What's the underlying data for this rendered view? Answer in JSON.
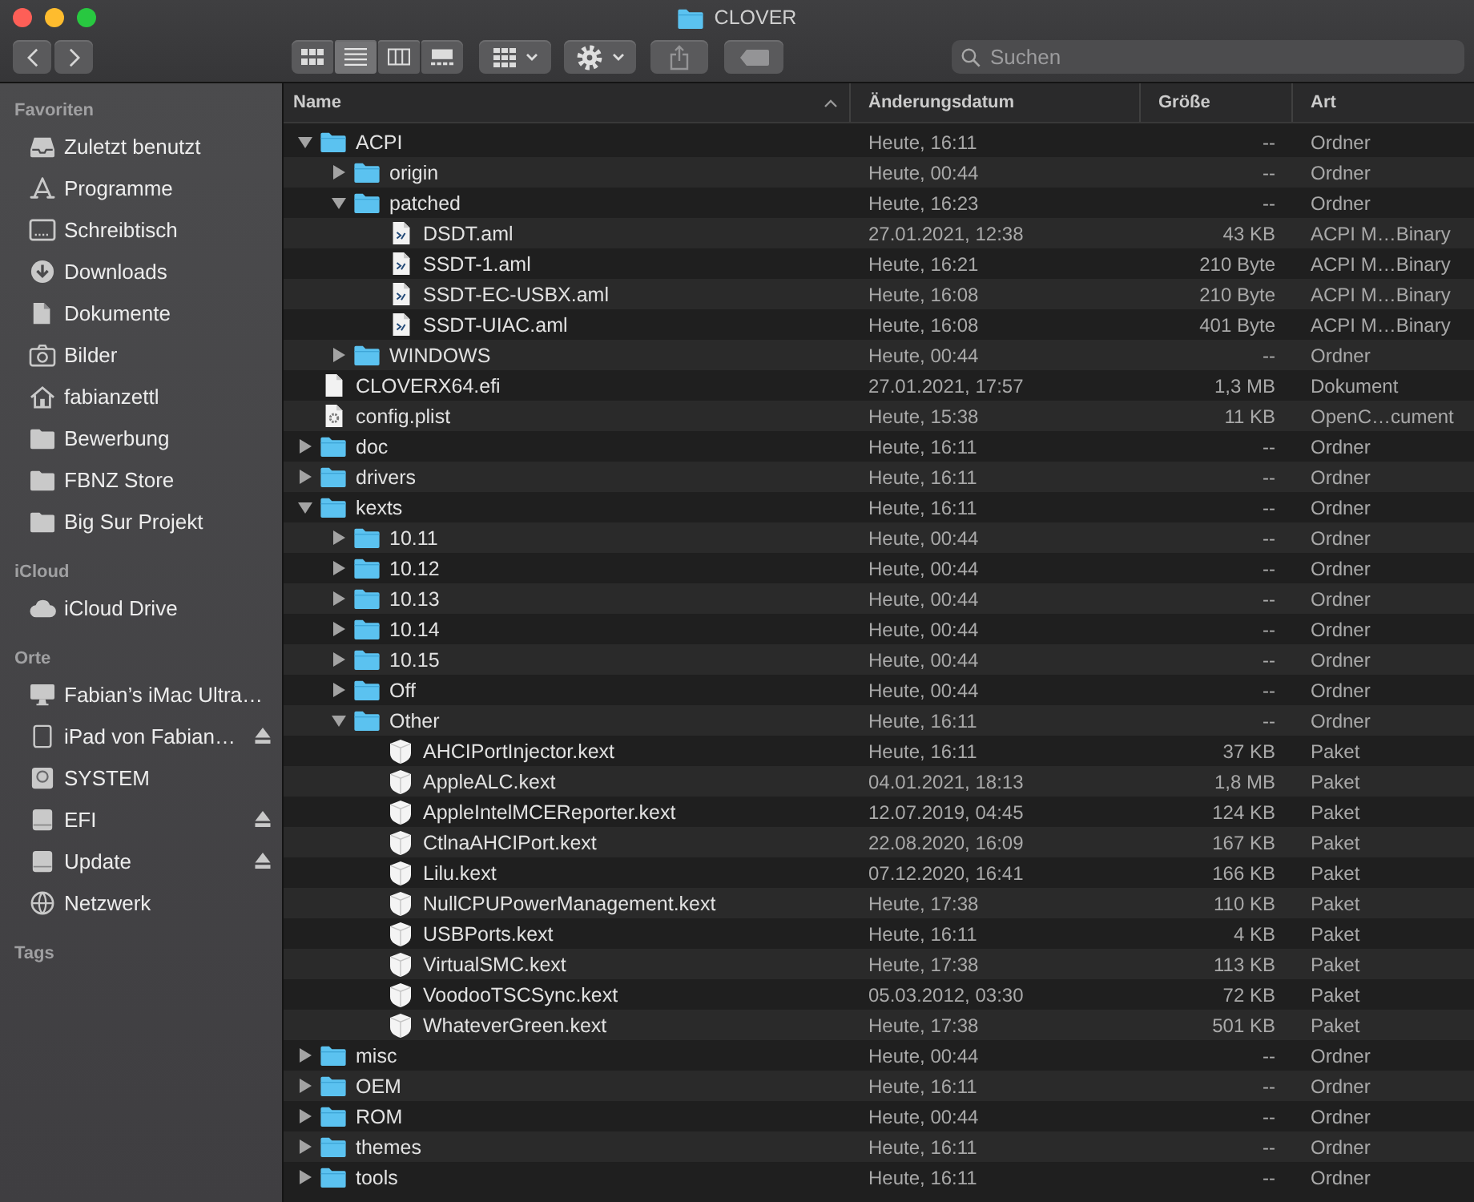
{
  "window": {
    "title": "CLOVER"
  },
  "toolbar": {
    "view_modes": [
      {
        "selected": false
      },
      {
        "selected": true
      },
      {
        "selected": false
      },
      {
        "selected": false
      }
    ],
    "group_button": {
      "disabled": false
    },
    "action_button": {
      "disabled": false
    },
    "share_button": {
      "disabled": true
    },
    "tag_button": {
      "disabled": true
    },
    "search": {
      "placeholder": "Suchen"
    }
  },
  "sidebar": {
    "sections": [
      {
        "title": "Favoriten",
        "items": [
          {
            "label": "Zuletzt benutzt"
          },
          {
            "label": "Programme"
          },
          {
            "label": "Schreibtisch"
          },
          {
            "label": "Downloads"
          },
          {
            "label": "Dokumente"
          },
          {
            "label": "Bilder"
          },
          {
            "label": "fabianzettl"
          },
          {
            "label": "Bewerbung"
          },
          {
            "label": "FBNZ Store"
          },
          {
            "label": "Big Sur Projekt"
          }
        ]
      },
      {
        "title": "iCloud",
        "items": [
          {
            "label": "iCloud Drive"
          }
        ]
      },
      {
        "title": "Orte",
        "items": [
          {
            "label": "Fabian’s iMac Ultra…",
            "ejectable": false
          },
          {
            "label": "iPad von Fabian…",
            "ejectable": true
          },
          {
            "label": "SYSTEM",
            "ejectable": false
          },
          {
            "label": "EFI",
            "ejectable": true
          },
          {
            "label": "Update",
            "ejectable": true
          },
          {
            "label": "Netzwerk",
            "ejectable": false
          }
        ]
      },
      {
        "title": "Tags"
      }
    ]
  },
  "table": {
    "columns": [
      {
        "label": "Name",
        "sorted": true
      },
      {
        "label": "Änderungsdatum",
        "sorted": false
      },
      {
        "label": "Größe",
        "sorted": false
      },
      {
        "label": "Art",
        "sorted": false
      }
    ],
    "rows": [
      {
        "name": "ACPI",
        "kind": "folder",
        "expanded": true,
        "modified": "Heute, 16:11",
        "size": "--",
        "type": "Ordner",
        "children": [
          {
            "name": "origin",
            "kind": "folder",
            "expanded": false,
            "modified": "Heute, 00:44",
            "size": "--",
            "type": "Ordner"
          },
          {
            "name": "patched",
            "kind": "folder",
            "expanded": true,
            "modified": "Heute, 16:23",
            "size": "--",
            "type": "Ordner",
            "children": [
              {
                "name": "DSDT.aml",
                "kind": "aml",
                "modified": "27.01.2021, 12:38",
                "size": "43 KB",
                "type": "ACPI M…Binary"
              },
              {
                "name": "SSDT-1.aml",
                "kind": "aml",
                "modified": "Heute, 16:21",
                "size": "210 Byte",
                "type": "ACPI M…Binary"
              },
              {
                "name": "SSDT-EC-USBX.aml",
                "kind": "aml",
                "modified": "Heute, 16:08",
                "size": "210 Byte",
                "type": "ACPI M…Binary"
              },
              {
                "name": "SSDT-UIAC.aml",
                "kind": "aml",
                "modified": "Heute, 16:08",
                "size": "401 Byte",
                "type": "ACPI M…Binary"
              }
            ]
          },
          {
            "name": "WINDOWS",
            "kind": "folder",
            "expanded": false,
            "modified": "Heute, 00:44",
            "size": "--",
            "type": "Ordner"
          }
        ]
      },
      {
        "name": "CLOVERX64.efi",
        "kind": "document",
        "modified": "27.01.2021, 17:57",
        "size": "1,3 MB",
        "type": "Dokument"
      },
      {
        "name": "config.plist",
        "kind": "plist",
        "modified": "Heute, 15:38",
        "size": "11 KB",
        "type": "OpenC…cument"
      },
      {
        "name": "doc",
        "kind": "folder",
        "expanded": false,
        "modified": "Heute, 16:11",
        "size": "--",
        "type": "Ordner"
      },
      {
        "name": "drivers",
        "kind": "folder",
        "expanded": false,
        "modified": "Heute, 16:11",
        "size": "--",
        "type": "Ordner"
      },
      {
        "name": "kexts",
        "kind": "folder",
        "expanded": true,
        "modified": "Heute, 16:11",
        "size": "--",
        "type": "Ordner",
        "children": [
          {
            "name": "10.11",
            "kind": "folder",
            "expanded": false,
            "modified": "Heute, 00:44",
            "size": "--",
            "type": "Ordner"
          },
          {
            "name": "10.12",
            "kind": "folder",
            "expanded": false,
            "modified": "Heute, 00:44",
            "size": "--",
            "type": "Ordner"
          },
          {
            "name": "10.13",
            "kind": "folder",
            "expanded": false,
            "modified": "Heute, 00:44",
            "size": "--",
            "type": "Ordner"
          },
          {
            "name": "10.14",
            "kind": "folder",
            "expanded": false,
            "modified": "Heute, 00:44",
            "size": "--",
            "type": "Ordner"
          },
          {
            "name": "10.15",
            "kind": "folder",
            "expanded": false,
            "modified": "Heute, 00:44",
            "size": "--",
            "type": "Ordner"
          },
          {
            "name": "Off",
            "kind": "folder",
            "expanded": false,
            "modified": "Heute, 00:44",
            "size": "--",
            "type": "Ordner"
          },
          {
            "name": "Other",
            "kind": "folder",
            "expanded": true,
            "modified": "Heute, 16:11",
            "size": "--",
            "type": "Ordner",
            "children": [
              {
                "name": "AHCIPortInjector.kext",
                "kind": "kext",
                "modified": "Heute, 16:11",
                "size": "37 KB",
                "type": "Paket"
              },
              {
                "name": "AppleALC.kext",
                "kind": "kext",
                "modified": "04.01.2021, 18:13",
                "size": "1,8 MB",
                "type": "Paket"
              },
              {
                "name": "AppleIntelMCEReporter.kext",
                "kind": "kext",
                "modified": "12.07.2019, 04:45",
                "size": "124 KB",
                "type": "Paket"
              },
              {
                "name": "CtlnaAHCIPort.kext",
                "kind": "kext",
                "modified": "22.08.2020, 16:09",
                "size": "167 KB",
                "type": "Paket"
              },
              {
                "name": "Lilu.kext",
                "kind": "kext",
                "modified": "07.12.2020, 16:41",
                "size": "166 KB",
                "type": "Paket"
              },
              {
                "name": "NullCPUPowerManagement.kext",
                "kind": "kext",
                "modified": "Heute, 17:38",
                "size": "110 KB",
                "type": "Paket"
              },
              {
                "name": "USBPorts.kext",
                "kind": "kext",
                "modified": "Heute, 16:11",
                "size": "4 KB",
                "type": "Paket"
              },
              {
                "name": "VirtualSMC.kext",
                "kind": "kext",
                "modified": "Heute, 17:38",
                "size": "113 KB",
                "type": "Paket"
              },
              {
                "name": "VoodooTSCSync.kext",
                "kind": "kext",
                "modified": "05.03.2012, 03:30",
                "size": "72 KB",
                "type": "Paket"
              },
              {
                "name": "WhateverGreen.kext",
                "kind": "kext",
                "modified": "Heute, 17:38",
                "size": "501 KB",
                "type": "Paket"
              }
            ]
          }
        ]
      },
      {
        "name": "misc",
        "kind": "folder",
        "expanded": false,
        "modified": "Heute, 00:44",
        "size": "--",
        "type": "Ordner"
      },
      {
        "name": "OEM",
        "kind": "folder",
        "expanded": false,
        "modified": "Heute, 16:11",
        "size": "--",
        "type": "Ordner"
      },
      {
        "name": "ROM",
        "kind": "folder",
        "expanded": false,
        "modified": "Heute, 00:44",
        "size": "--",
        "type": "Ordner"
      },
      {
        "name": "themes",
        "kind": "folder",
        "expanded": false,
        "modified": "Heute, 16:11",
        "size": "--",
        "type": "Ordner"
      },
      {
        "name": "tools",
        "kind": "folder",
        "expanded": false,
        "modified": "Heute, 16:11",
        "size": "--",
        "type": "Ordner"
      }
    ]
  }
}
